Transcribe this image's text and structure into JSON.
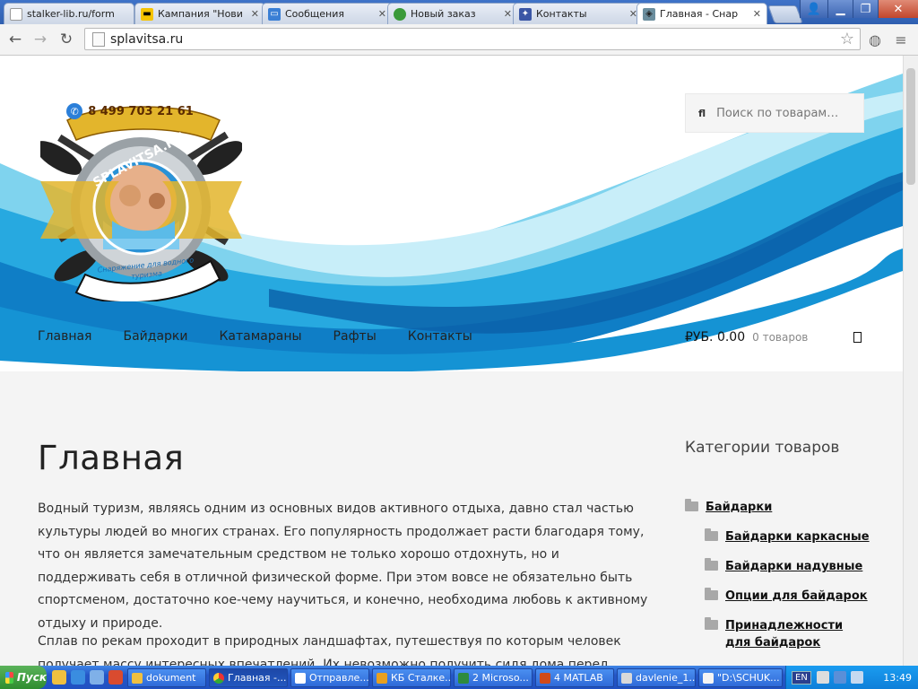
{
  "browser": {
    "tabs": [
      {
        "title": "stalker-lib.ru/form",
        "icon": "page-icon",
        "color": "#ffffff"
      },
      {
        "title": "Кампания \"Нови",
        "icon": "yandex-direct-icon",
        "color": "#f5c300"
      },
      {
        "title": "Сообщения",
        "icon": "message-icon",
        "color": "#3a7fd5"
      },
      {
        "title": "Новый заказ",
        "icon": "order-icon",
        "color": "#3a9a3a"
      },
      {
        "title": "Контакты",
        "icon": "emblem-icon",
        "color": "#3a56a5"
      },
      {
        "title": "Главная - Снар",
        "icon": "site-favicon",
        "color": "#6b8e9e"
      }
    ],
    "url": "splavitsa.ru"
  },
  "site": {
    "phone": "8 499 703 21 61",
    "logo_text": "SPLAVITSA.RU",
    "logo_slogan": "Снаряжение для водного туризма",
    "search_placeholder": "Поиск по товарам…",
    "nav": [
      "Главная",
      "Байдарки",
      "Катамараны",
      "Рафты",
      "Контакты"
    ],
    "cart": {
      "amount": "₽УБ. 0.00",
      "count": "0 товаров"
    },
    "page_title": "Главная",
    "paragraphs": [
      "Водный туризм, являясь одним из основных видов активного отдыха, давно стал частью культуры людей во многих странах. Его популярность продолжает расти благодаря тому, что он является замечательным средством не только хорошо отдохнуть, но и поддерживать себя в отличной физической форме. При этом вовсе не обязательно быть спортсменом, достаточно кое-чему научиться, и конечно, необходима любовь к активному отдыху и природе.",
      "Сплав по рекам проходит в природных ландшафтах, путешествуя по которым человек получает массу интересных впечатлений. Их невозможно получить сидя дома перед экраном и наблюдая"
    ],
    "categories_heading": "Категории товаров",
    "categories": [
      {
        "label": "Байдарки",
        "level": 0
      },
      {
        "label": "Байдарки каркасные",
        "level": 1
      },
      {
        "label": "Байдарки надувные",
        "level": 1
      },
      {
        "label": "Опции для байдарок",
        "level": 1
      },
      {
        "label": "Принадлежности для байдарок",
        "level": 1
      }
    ]
  },
  "taskbar": {
    "start": "Пуск",
    "tasks": [
      {
        "label": "dokument",
        "icon": "folder-icon"
      },
      {
        "label": "Главная -...",
        "icon": "chrome-icon"
      },
      {
        "label": "Отправле...",
        "icon": "mail-icon"
      },
      {
        "label": "КБ Сталке...",
        "icon": "browser-icon"
      },
      {
        "label": "2 Microso...",
        "icon": "excel-icon"
      },
      {
        "label": "4 MATLAB",
        "icon": "matlab-icon"
      },
      {
        "label": "davlenie_1...",
        "icon": "image-icon"
      },
      {
        "label": "\"D:\\SCHUK...",
        "icon": "notepad-icon"
      }
    ],
    "lang": "EN",
    "clock": "13:49"
  }
}
